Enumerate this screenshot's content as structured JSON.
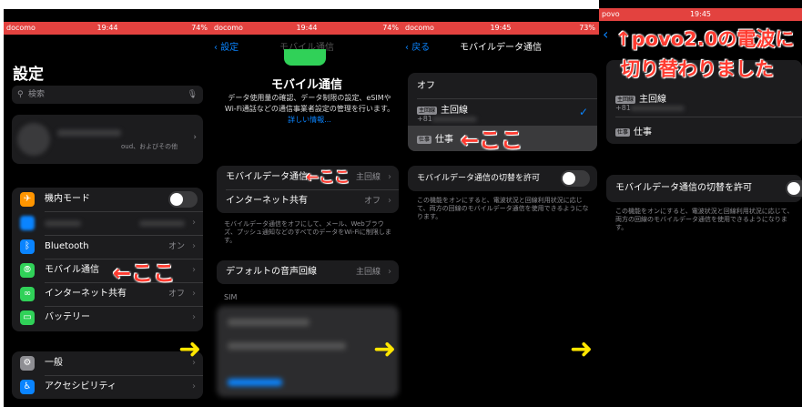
{
  "panel1": {
    "status": {
      "carrier": "docomo",
      "time": "19:44",
      "battery": "74%"
    },
    "title": "設定",
    "search_placeholder": "検索",
    "profile_sub": "oud、およびその他",
    "airplane_label": "機内モード",
    "bluetooth_label": "Bluetooth",
    "bluetooth_value": "オン",
    "mobile_label": "モバイル通信",
    "hotspot_label": "インターネット共有",
    "hotspot_value": "オフ",
    "battery_label": "バッテリー",
    "general_label": "一般",
    "accessibility_label": "アクセシビリティ",
    "annotation": "←ここ"
  },
  "panel2": {
    "status": {
      "carrier": "docomo",
      "time": "19:44",
      "battery": "74%"
    },
    "back_label": "設定",
    "nav_title": "モバイル通信",
    "heading": "モバイル通信",
    "description": "データ使用量の確認、データ制限の設定、eSIMやWi-Fi通話などの通信事業者設定の管理を行います。",
    "more_link": "詳しい情報...",
    "mobile_data_label": "モバイルデータ通信",
    "mobile_data_value": "主回線",
    "hotspot_label": "インターネット共有",
    "hotspot_value": "オフ",
    "note": "モバイルデータ通信をオフにして、メール、Webブラウズ、プッシュ通知などのすべてのデータをWi-Fiに制限します。",
    "voice_label": "デフォルトの音声回線",
    "voice_value": "主回線",
    "sim_header": "SIM",
    "annotation": "←ここ"
  },
  "panel3": {
    "status": {
      "carrier": "docomo",
      "time": "19:45",
      "battery": "73%"
    },
    "back_label": "戻る",
    "nav_title": "モバイルデータ通信",
    "off_label": "オフ",
    "line1_badge": "主回線",
    "line1_label": "主回線",
    "line1_number": "+81",
    "line2_badge": "仕事",
    "line2_label": "仕事",
    "switch_label": "モバイルデータ通信の切替を許可",
    "note": "この機能をオンにすると、電波状況と回線利用状況に応じて、両方の回線のモバイルデータ通信を使用できるようになります。",
    "annotation": "←ここ",
    "check_icon": "✓"
  },
  "panel4": {
    "status": {
      "carrier": "povo",
      "time": "19:45"
    },
    "caption_line1": "↑povo2.0の電波に",
    "caption_line2": "切り替わりました",
    "line1_badge": "主回線",
    "line1_label": "主回線",
    "line1_number": "+81",
    "line2_badge": "仕事",
    "line2_label": "仕事",
    "switch_label": "モバイルデータ通信の切替を許可",
    "note": "この機能をオンにすると、電波状況と回線利用状況に応じて、両方の回線のモバイルデータ通信を使用できるようになります。"
  },
  "arrows": {
    "glyph": "➜"
  },
  "colors": {
    "status_red": "#e3423f",
    "annotation_red": "#ff3b30",
    "arrow_yellow": "#ffe600",
    "link_blue": "#0a84ff"
  }
}
